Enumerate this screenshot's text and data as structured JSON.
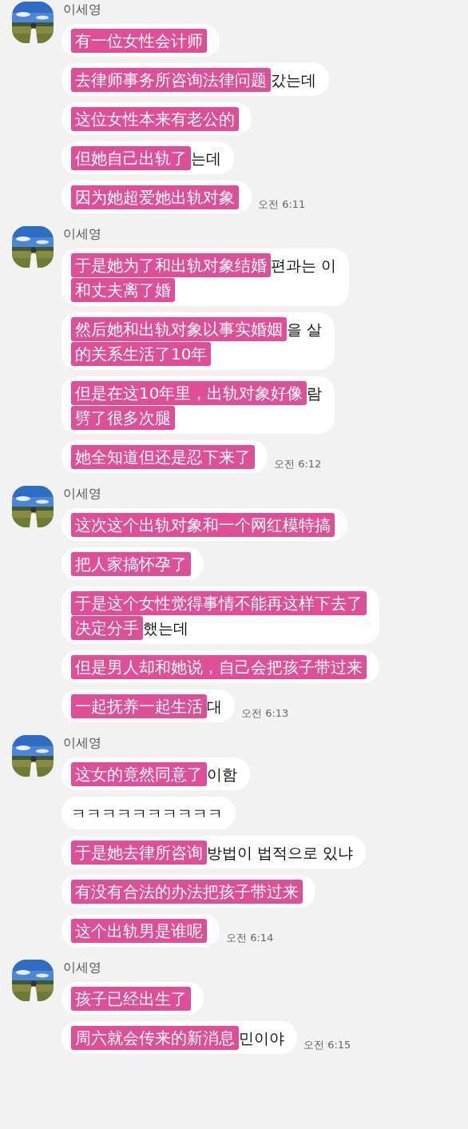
{
  "groups": [
    {
      "sender": "이세영",
      "avatar": {
        "kind": "picture"
      },
      "time": "오전 6:11",
      "messages": [
        {
          "lines": [
            {
              "caption": "有一位女性会计师"
            }
          ]
        },
        {
          "lines": [
            {
              "caption": "去律师事务所咨询法律问题",
              "tail": "갔는데"
            }
          ]
        },
        {
          "lines": [
            {
              "caption": "这位女性本来有老公的"
            }
          ]
        },
        {
          "lines": [
            {
              "caption": "但她自己出轨了",
              "tail": "는데"
            }
          ]
        },
        {
          "lines": [
            {
              "caption": "因为她超爱她出轨对象"
            }
          ]
        }
      ]
    },
    {
      "sender": "이세영",
      "avatar": {
        "kind": "picture"
      },
      "time": "오전 6:12",
      "messages": [
        {
          "lines": [
            {
              "caption": "于是她为了和出轨对象结婚",
              "tail": "편과는 이"
            },
            {
              "caption": "和丈夫离了婚"
            }
          ]
        },
        {
          "lines": [
            {
              "caption": "然后她和出轨对象以事实婚姻",
              "tail": "을 살"
            },
            {
              "caption": "的关系生活了10年"
            }
          ]
        },
        {
          "lines": [
            {
              "caption": "但是在这10年里，出轨对象好像",
              "tail": "람"
            },
            {
              "caption": "劈了很多次腿"
            }
          ]
        },
        {
          "lines": [
            {
              "caption": "她全知道但还是忍下来了"
            }
          ]
        }
      ]
    },
    {
      "sender": "이세영",
      "avatar": {
        "kind": "picture"
      },
      "time": "오전 6:13",
      "messages": [
        {
          "lines": [
            {
              "caption": "这次这个出轨对象和一个网红模特搞"
            }
          ]
        },
        {
          "lines": [
            {
              "caption": "把人家搞怀孕了"
            }
          ]
        },
        {
          "lines": [
            {
              "caption": "于是这个女性觉得事情不能再这样下去了"
            },
            {
              "caption": "决定分手",
              "tail": "했는데"
            }
          ]
        },
        {
          "lines": [
            {
              "caption": "但是男人却和她说，自己会把孩子带过来"
            }
          ]
        },
        {
          "lines": [
            {
              "caption": "一起抚养一起生活",
              "tail": "대"
            }
          ]
        }
      ]
    },
    {
      "sender": "이세영",
      "avatar": {
        "kind": "picture"
      },
      "time": "오전 6:14",
      "messages": [
        {
          "lines": [
            {
              "caption": "这女的竟然同意了",
              "tail": "이함"
            }
          ]
        },
        {
          "lines": [
            {
              "tail": "ㅋㅋㅋㅋㅋㅋㅋㅋㅋㅋ"
            }
          ]
        },
        {
          "lines": [
            {
              "caption": "于是她去律所咨询",
              "tail": "방법이 법적으로 있냐"
            }
          ]
        },
        {
          "lines": [
            {
              "caption": "有没有合法的办法把孩子带过来"
            }
          ]
        },
        {
          "lines": [
            {
              "caption": "这个出轨男是谁呢"
            }
          ]
        }
      ]
    },
    {
      "sender": "이세영",
      "avatar": {
        "kind": "picture"
      },
      "time": "오전 6:15",
      "messages": [
        {
          "lines": [
            {
              "caption": "孩子已经出生了"
            }
          ]
        },
        {
          "lines": [
            {
              "caption": "周六就会传来的新消息",
              "tail": "민이야"
            }
          ]
        }
      ]
    }
  ]
}
